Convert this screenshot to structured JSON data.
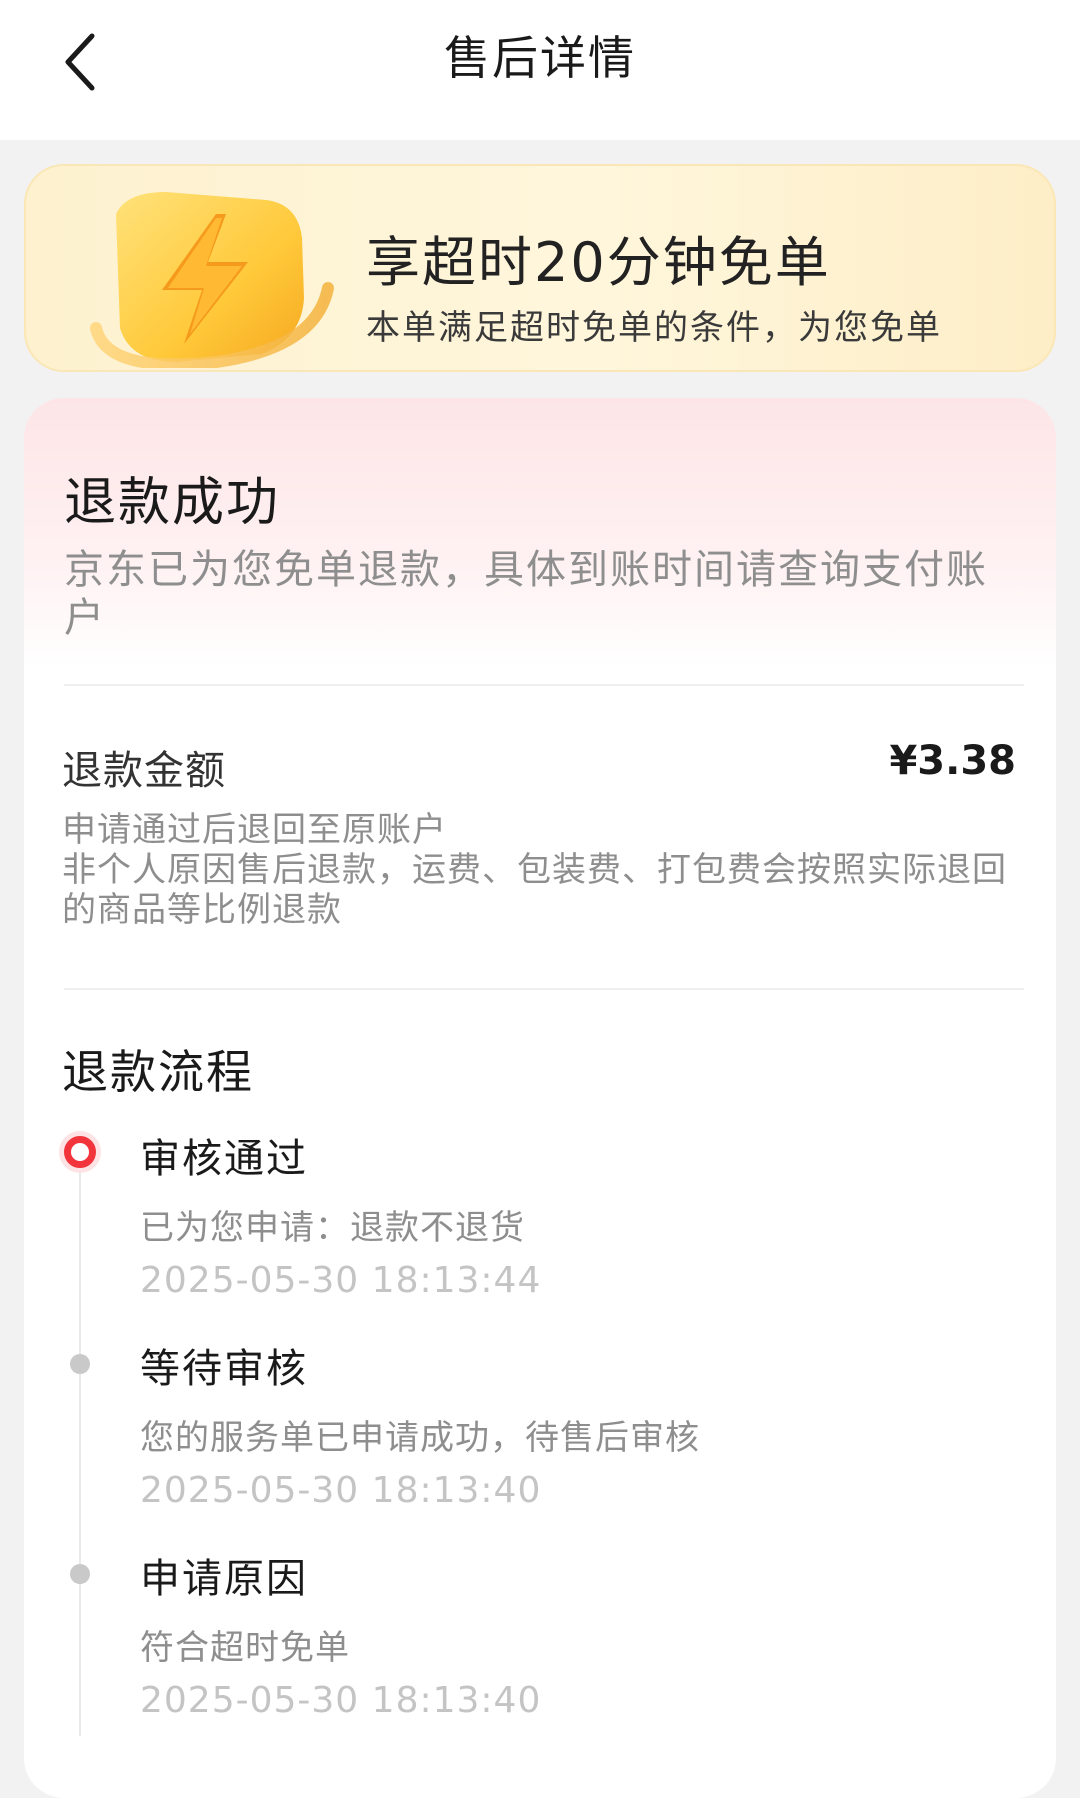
{
  "header": {
    "title": "售后详情",
    "back_icon": "chevron-left-icon"
  },
  "promo": {
    "icon": "lightning-shield-icon",
    "title": "享超时20分钟免单",
    "subtitle": "本单满足超时免单的条件，为您免单"
  },
  "status": {
    "title": "退款成功",
    "description": "京东已为您免单退款，具体到账时间请查询支付账户"
  },
  "refund": {
    "label": "退款金额",
    "amount": "¥3.38",
    "note_line1": "申请通过后退回至原账户",
    "note_line2": "非个人原因售后退款，运费、包装费、打包费会按照实际退回的商品等比例退款"
  },
  "process": {
    "title": "退款流程",
    "steps": [
      {
        "name": "审核通过",
        "desc": "已为您申请：退款不退货",
        "time": "2025-05-30 18:13:44",
        "active": true
      },
      {
        "name": "等待审核",
        "desc": "您的服务单已申请成功，待售后审核",
        "time": "2025-05-30 18:13:40",
        "active": false
      },
      {
        "name": "申请原因",
        "desc": "符合超时免单",
        "time": "2025-05-30 18:13:40",
        "active": false
      }
    ]
  },
  "colors": {
    "accent": "#f2353d",
    "promo_bg": "#fdf1cf",
    "status_bg": "#fde5e7"
  }
}
